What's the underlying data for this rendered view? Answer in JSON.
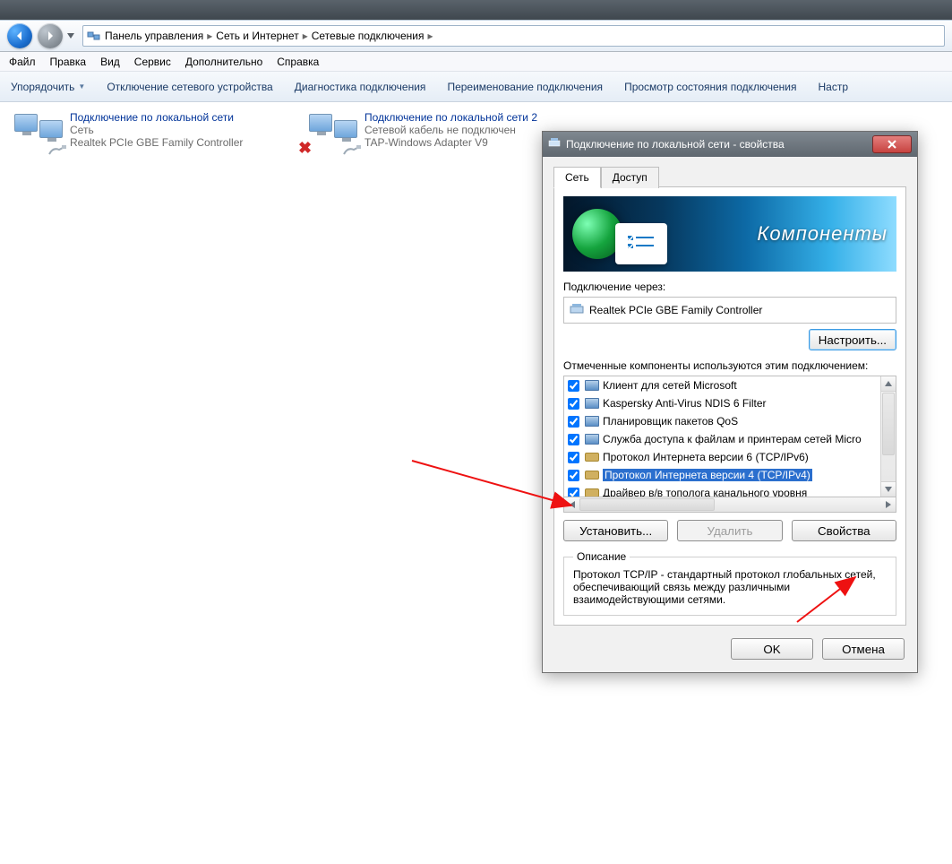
{
  "breadcrumb": {
    "items": [
      "Панель управления",
      "Сеть и Интернет",
      "Сетевые подключения"
    ]
  },
  "menu": {
    "file": "Файл",
    "edit": "Правка",
    "view": "Вид",
    "tools": "Сервис",
    "advanced": "Дополнительно",
    "help": "Справка"
  },
  "cmd": {
    "organize": "Упорядочить",
    "disable": "Отключение сетевого устройства",
    "diagnose": "Диагностика подключения",
    "rename": "Переименование подключения",
    "status": "Просмотр состояния подключения",
    "settings": "Настр"
  },
  "connections": {
    "c1": {
      "title": "Подключение по локальной сети",
      "line2": "Сеть",
      "line3": "Realtek PCIe GBE Family Controller"
    },
    "c2": {
      "title": "Подключение по локальной сети 2",
      "line2": "Сетевой кабель не подключен",
      "line3": "TAP-Windows Adapter V9"
    }
  },
  "dialog": {
    "title": "Подключение по локальной сети - свойства",
    "tabs": {
      "network": "Сеть",
      "access": "Доступ"
    },
    "banner_word": "Компоненты",
    "connect_via_label": "Подключение через:",
    "adapter": "Realtek PCIe GBE Family Controller",
    "configure": "Настроить...",
    "components_label": "Отмеченные компоненты используются этим подключением:",
    "components": [
      {
        "name": "Клиент для сетей Microsoft",
        "checked": true,
        "selected": false,
        "icon": "svc"
      },
      {
        "name": "Kaspersky Anti-Virus NDIS 6 Filter",
        "checked": true,
        "selected": false,
        "icon": "svc"
      },
      {
        "name": "Планировщик пакетов QoS",
        "checked": true,
        "selected": false,
        "icon": "svc"
      },
      {
        "name": "Служба доступа к файлам и принтерам сетей Micro",
        "checked": true,
        "selected": false,
        "icon": "svc"
      },
      {
        "name": "Протокол Интернета версии 6 (TCP/IPv6)",
        "checked": true,
        "selected": false,
        "icon": "plug"
      },
      {
        "name": "Протокол Интернета версии 4 (TCP/IPv4)",
        "checked": true,
        "selected": true,
        "icon": "plug"
      },
      {
        "name": "Драйвер в/в тополога канального уровня",
        "checked": true,
        "selected": false,
        "icon": "plug"
      }
    ],
    "install": "Установить...",
    "remove": "Удалить",
    "properties": "Свойства",
    "desc_legend": "Описание",
    "description": "Протокол TCP/IP - стандартный протокол глобальных сетей, обеспечивающий связь между различными взаимодействующими сетями.",
    "ok": "OK",
    "cancel": "Отмена"
  }
}
